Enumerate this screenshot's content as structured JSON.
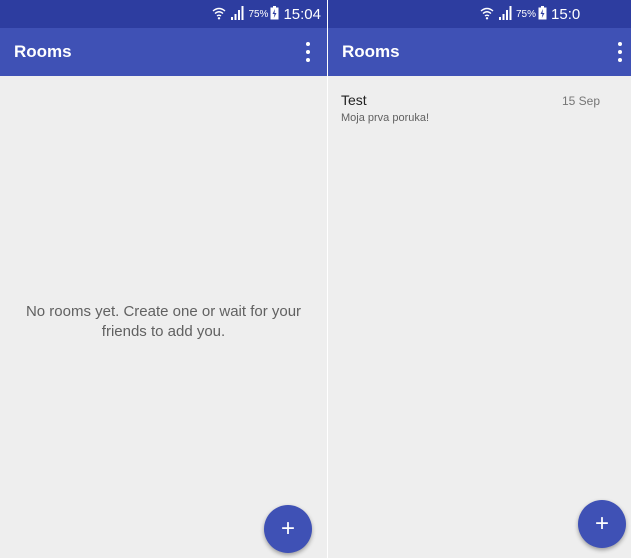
{
  "colors": {
    "status_bar": "#2d3da0",
    "app_bar": "#3f51b5",
    "background": "#eeeeee",
    "fab": "#3f51b5"
  },
  "status_bar": {
    "battery": "75%",
    "time_left": "15:04",
    "time_right": "15:0"
  },
  "icons": {
    "wifi": "wifi-icon",
    "signal": "signal-icon",
    "battery": "battery-icon",
    "menu": "more-vert-icon",
    "fab": "plus-icon"
  },
  "left_screen": {
    "title": "Rooms",
    "empty_message": "No rooms yet. Create one or wait for your friends to add you.",
    "fab_label": "+"
  },
  "right_screen": {
    "title": "Rooms",
    "rooms": [
      {
        "name": "Test",
        "date": "15 Sep",
        "preview": "Moja prva poruka!"
      }
    ],
    "fab_label": "+"
  }
}
